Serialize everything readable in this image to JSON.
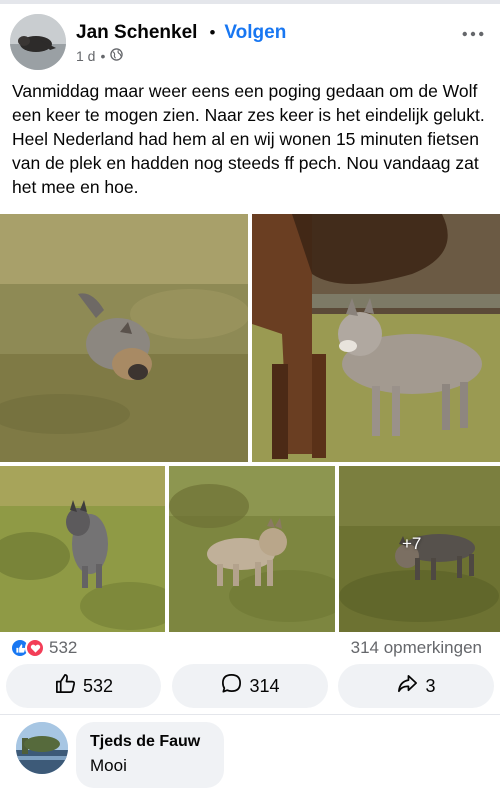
{
  "post": {
    "author": "Jan Schenkel",
    "separator": "•",
    "follow_label": "Volgen",
    "time": "1 d",
    "meta_dot": "•",
    "text": "Vanmiddag maar weer eens een poging gedaan om de Wolf een keer te mogen zien. Naar zes keer is het eindelijk gelukt. Heel Nederland had hem al en wij wonen 15 minuten fietsen van de plek en hadden nog steeds ff pech. Nou vandaag zat het mee en hoe.",
    "more_photos": "+7"
  },
  "stats": {
    "reaction_count": "532",
    "comments": "314 opmerkingen"
  },
  "actions": {
    "like": "532",
    "comment": "314",
    "share": "3"
  },
  "comment": {
    "author": "Tjeds de Fauw",
    "text": "Mooi"
  },
  "colors": {
    "accent": "#1877f2",
    "love": "#f33e58",
    "muted": "#65676b",
    "button_bg": "#f0f2f5"
  },
  "icons": {
    "more": "more-horizontal-icon",
    "audience": "globe-icon",
    "like_reaction": "like-reaction-icon",
    "love_reaction": "love-reaction-icon",
    "like_button": "thumbs-up-icon",
    "comment_button": "comment-bubble-icon",
    "share_button": "share-arrow-icon"
  }
}
